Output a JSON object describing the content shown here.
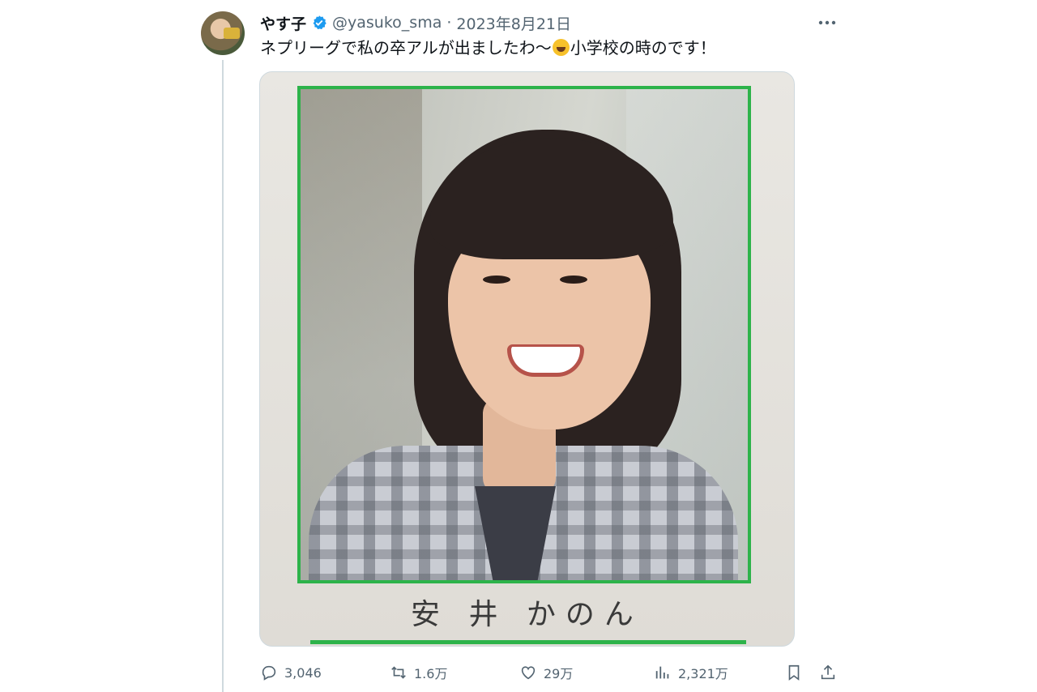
{
  "tweet": {
    "display_name": "やす子",
    "handle": "@yasuko_sma",
    "separator": "·",
    "date": "2023年8月21日",
    "text_before_emoji": "ネプリーグで私の卒アルが出ましたわ〜",
    "emoji": "grinning-squinting-face",
    "text_after_emoji": "小学校の時のです！",
    "more_icon": "more-horizontal-icon",
    "verified_color": "#1d9bf0"
  },
  "media": {
    "photo_caption": "安 井 かのん",
    "frame_color": "#2db34a"
  },
  "actions": {
    "replies": "3,046",
    "retweets": "1.6万",
    "likes": "29万",
    "views": "2,321万"
  }
}
